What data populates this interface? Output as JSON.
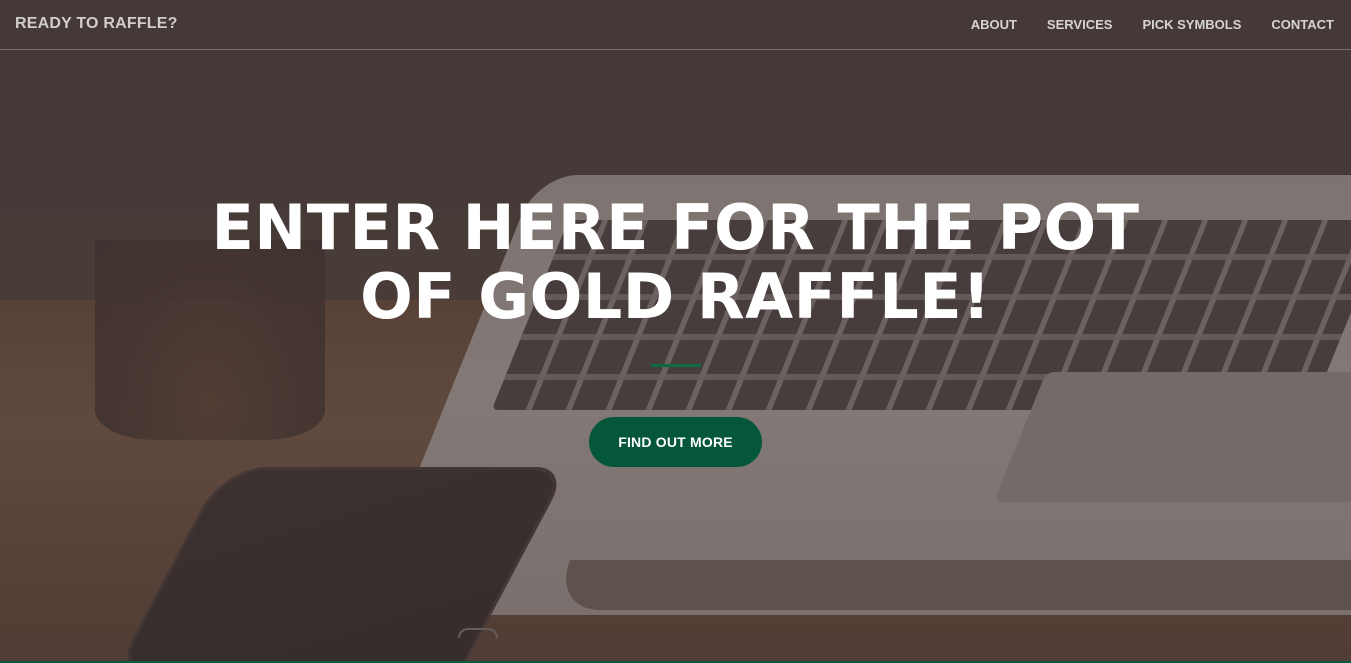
{
  "brand": "READY TO RAFFLE?",
  "nav": {
    "items": [
      {
        "label": "ABOUT"
      },
      {
        "label": "SERVICES"
      },
      {
        "label": "PICK SYMBOLS"
      },
      {
        "label": "CONTACT"
      }
    ]
  },
  "hero": {
    "headline": "ENTER HERE FOR THE POT OF GOLD RAFFLE!",
    "button_label": "FIND OUT MORE"
  },
  "colors": {
    "accent": "#04573a",
    "divider": "#0c6b43",
    "text": "#ffffff"
  }
}
